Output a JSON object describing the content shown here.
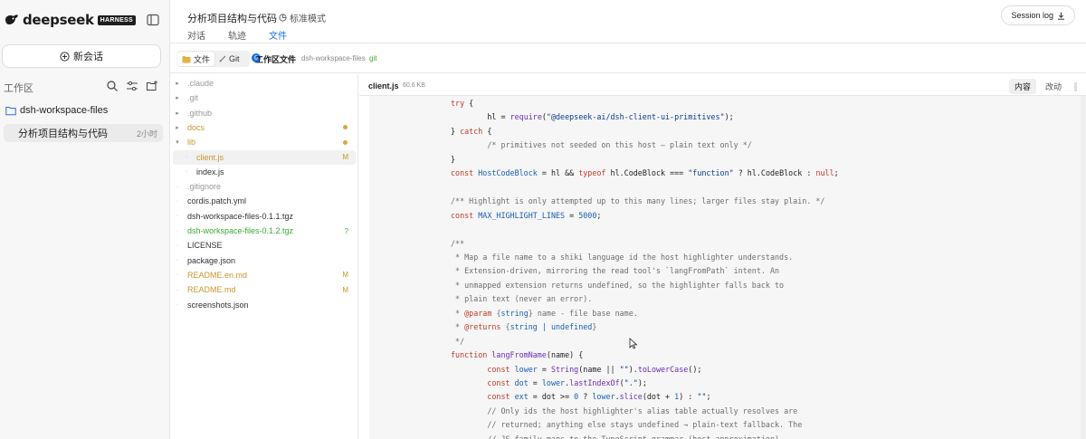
{
  "brand": {
    "name": "deepseek",
    "badge": "HARNESS"
  },
  "sidebar": {
    "new_chat_label": "新会话",
    "workspace_label": "工作区",
    "workspace_folder": "dsh-workspace-files",
    "session": {
      "title": "分析项目结构与代码",
      "time": "2小时"
    }
  },
  "header": {
    "title": "分析项目结构与代码",
    "mode": "标准模式",
    "tabs": [
      {
        "label": "对话",
        "active": false
      },
      {
        "label": "轨迹",
        "active": false
      },
      {
        "label": "文件",
        "active": true
      }
    ],
    "session_log_label": "Session log"
  },
  "toolbar": {
    "files_label": "文件",
    "git_label": "Git",
    "git_count": "6",
    "title": "工作区文件",
    "path": "dsh-workspace-files",
    "git_tag": "git"
  },
  "tree": [
    {
      "name": ".claude",
      "kind": "dir",
      "status": "",
      "style": "ign"
    },
    {
      "name": ".git",
      "kind": "dir",
      "status": "",
      "style": "ign"
    },
    {
      "name": ".github",
      "kind": "dir",
      "status": "",
      "style": "ign"
    },
    {
      "name": "docs",
      "kind": "dir",
      "status": "dot",
      "style": "mod"
    },
    {
      "name": "lib",
      "kind": "dir-open",
      "status": "dot",
      "style": "mod"
    },
    {
      "name": "client.js",
      "kind": "file-child",
      "status": "M",
      "style": "mod",
      "selected": true
    },
    {
      "name": "index.js",
      "kind": "file-child",
      "status": "",
      "style": "norm"
    },
    {
      "name": ".gitignore",
      "kind": "file",
      "status": "",
      "style": "ign"
    },
    {
      "name": "cordis.patch.yml",
      "kind": "file",
      "status": "",
      "style": "norm"
    },
    {
      "name": "dsh-workspace-files-0.1.1.tgz",
      "kind": "file",
      "status": "",
      "style": "norm"
    },
    {
      "name": "dsh-workspace-files-0.1.2.tgz",
      "kind": "file",
      "status": "?",
      "style": "new"
    },
    {
      "name": "LICENSE",
      "kind": "file",
      "status": "",
      "style": "norm"
    },
    {
      "name": "package.json",
      "kind": "file",
      "status": "",
      "style": "norm"
    },
    {
      "name": "README.en.md",
      "kind": "file",
      "status": "M",
      "style": "mod"
    },
    {
      "name": "README.md",
      "kind": "file",
      "status": "M",
      "style": "mod"
    },
    {
      "name": "screenshots.json",
      "kind": "file",
      "status": "",
      "style": "norm"
    }
  ],
  "code": {
    "filename": "client.js",
    "size": "60.6 KB",
    "view_content": "内容",
    "view_changes": "改动",
    "lines": [
      [
        [
          "kw",
          "try"
        ],
        [
          "",
          " {"
        ]
      ],
      [
        [
          "",
          "        hl = "
        ],
        [
          "fn",
          "require"
        ],
        [
          "",
          "("
        ],
        [
          "str",
          "\"@deepseek-ai/dsh-client-ui-primitives\""
        ],
        [
          "",
          ");"
        ]
      ],
      [
        [
          "",
          "} "
        ],
        [
          "kw",
          "catch"
        ],
        [
          "",
          " {"
        ]
      ],
      [
        [
          "cm",
          "        /* primitives not seeded on this host — plain text only */"
        ]
      ],
      [
        [
          "",
          "}"
        ]
      ],
      [
        [
          "kw",
          "const"
        ],
        [
          "",
          " "
        ],
        [
          "cn",
          "HostCodeBlock"
        ],
        [
          "",
          " = hl && "
        ],
        [
          "kw",
          "typeof"
        ],
        [
          "",
          " hl.CodeBlock === "
        ],
        [
          "str",
          "\"function\""
        ],
        [
          "",
          " ? hl.CodeBlock : "
        ],
        [
          "kw",
          "null"
        ],
        [
          "",
          ";"
        ]
      ],
      [
        [
          "",
          ""
        ]
      ],
      [
        [
          "cm",
          "/** Highlight is only attempted up to this many lines; larger files stay plain. */"
        ]
      ],
      [
        [
          "kw",
          "const"
        ],
        [
          "",
          " "
        ],
        [
          "cn",
          "MAX_HIGHLIGHT_LINES"
        ],
        [
          "",
          " = "
        ],
        [
          "cn",
          "5000"
        ],
        [
          "",
          ";"
        ]
      ],
      [
        [
          "",
          ""
        ]
      ],
      [
        [
          "cm",
          "/**"
        ]
      ],
      [
        [
          "cm",
          " * Map a file name to a shiki language id the host highlighter understands."
        ]
      ],
      [
        [
          "cm",
          " * Extension-driven, mirroring the read tool's `langFromPath` intent. An"
        ]
      ],
      [
        [
          "cm",
          " * unmapped extension returns undefined, so the highlighter falls back to"
        ]
      ],
      [
        [
          "cm",
          " * plain text (never an error)."
        ]
      ],
      [
        [
          "cm",
          " * "
        ],
        [
          "kw",
          "@param"
        ],
        [
          "cm",
          " {"
        ],
        [
          "cn",
          "string"
        ],
        [
          "cm",
          "} name - file base name."
        ]
      ],
      [
        [
          "cm",
          " * "
        ],
        [
          "kw",
          "@returns"
        ],
        [
          "cm",
          " {"
        ],
        [
          "cn",
          "string | undefined"
        ],
        [
          "cm",
          "}"
        ]
      ],
      [
        [
          "cm",
          " */"
        ]
      ],
      [
        [
          "kw",
          "function"
        ],
        [
          "",
          " "
        ],
        [
          "fn",
          "langFromName"
        ],
        [
          "",
          "(name) {"
        ]
      ],
      [
        [
          "",
          "        "
        ],
        [
          "kw",
          "const"
        ],
        [
          "",
          " "
        ],
        [
          "cn",
          "lower"
        ],
        [
          "",
          " = "
        ],
        [
          "fn",
          "String"
        ],
        [
          "",
          "(name || "
        ],
        [
          "str",
          "\"\""
        ],
        [
          "",
          ")."
        ],
        [
          "fn",
          "toLowerCase"
        ],
        [
          "",
          "();"
        ]
      ],
      [
        [
          "",
          "        "
        ],
        [
          "kw",
          "const"
        ],
        [
          "",
          " "
        ],
        [
          "cn",
          "dot"
        ],
        [
          "",
          " = "
        ],
        [
          "cn",
          "lower"
        ],
        [
          "",
          "."
        ],
        [
          "fn",
          "lastIndexOf"
        ],
        [
          "",
          "("
        ],
        [
          "str",
          "\".\""
        ],
        [
          "",
          ");"
        ]
      ],
      [
        [
          "",
          "        "
        ],
        [
          "kw",
          "const"
        ],
        [
          "",
          " "
        ],
        [
          "cn",
          "ext"
        ],
        [
          "",
          " = dot >= "
        ],
        [
          "cn",
          "0"
        ],
        [
          "",
          " ? "
        ],
        [
          "cn",
          "lower"
        ],
        [
          "",
          "."
        ],
        [
          "fn",
          "slice"
        ],
        [
          "",
          "(dot + "
        ],
        [
          "cn",
          "1"
        ],
        [
          "",
          ") : "
        ],
        [
          "str",
          "\"\""
        ],
        [
          "",
          ";"
        ]
      ],
      [
        [
          "cm",
          "        // Only ids the host highlighter's alias table actually resolves are"
        ]
      ],
      [
        [
          "cm",
          "        // returned; anything else stays undefined → plain-text fallback. The"
        ]
      ],
      [
        [
          "cm",
          "        // JS family maps to the TypeScript grammar (host approximation)"
        ]
      ]
    ]
  }
}
